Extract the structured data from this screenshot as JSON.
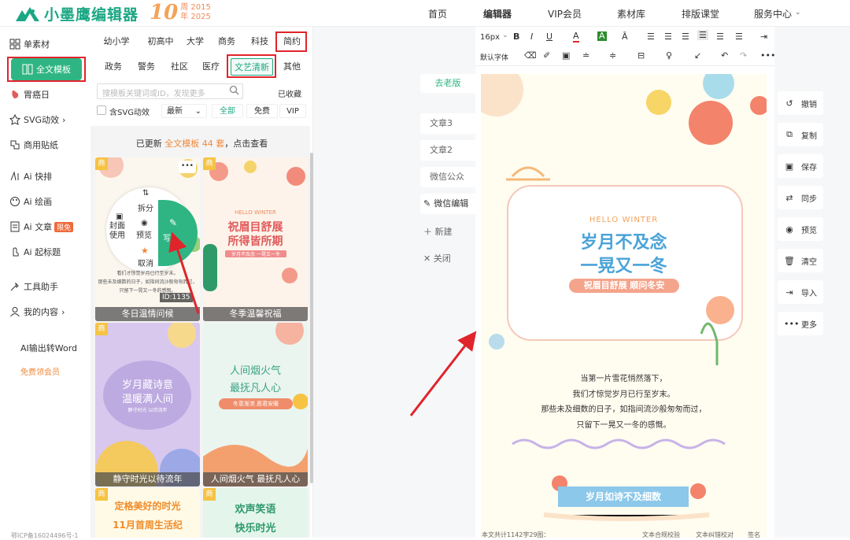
{
  "header": {
    "logo_text": "小墨鹰编辑器",
    "anniversary_num": "10",
    "anniversary_line1": "周 2015",
    "anniversary_line2": "年 2025",
    "nav": [
      "首页",
      "编辑器",
      "VIP会员",
      "素材库",
      "排版课堂",
      "服务中心"
    ]
  },
  "sidebar": {
    "items": [
      {
        "label": "单素材"
      },
      {
        "label": "全文模板"
      },
      {
        "label": "胃癌日"
      },
      {
        "label": "SVG动效",
        "chevron": "›"
      },
      {
        "label": "商用贴纸"
      },
      {
        "label": "Ai 快排"
      },
      {
        "label": "Ai 绘画"
      },
      {
        "label": "Ai 文章",
        "badge": "限免"
      },
      {
        "label": "Ai 起标题"
      },
      {
        "label": "工具助手"
      },
      {
        "label": "我的内容",
        "chevron": "›"
      }
    ],
    "ai_word": "AI输出转Word",
    "free_vip": "免费领会员",
    "icp": "鄂ICP备16024496号-1"
  },
  "templates": {
    "tags_row1": [
      "幼小学",
      "初高中",
      "大学",
      "商务",
      "科技",
      "简约"
    ],
    "tags_row2": [
      "政务",
      "警务",
      "社区",
      "医疗",
      "文艺清新",
      "其他"
    ],
    "search_placeholder": "搜模板关键词或ID，发现更多",
    "favorites": "已收藏",
    "svg_check": "含SVG动效",
    "sort": "最新",
    "filters": [
      "全部",
      "免费",
      "VIP"
    ],
    "update_prefix": "已更新",
    "update_highlight": "全文模板 44 套",
    "update_suffix": "，点击查看",
    "cards": [
      {
        "caption": "冬日温情问候",
        "id": "ID:1135"
      },
      {
        "caption": "冬季温馨祝福",
        "title1": "祝眉目舒展",
        "title2": "所得皆所期",
        "en": "HELLO WINTER",
        "sub": "岁月不及念 一晃又一冬"
      },
      {
        "caption": "静守时光以待流年",
        "title1": "岁月藏诗意",
        "title2": "温暖满人间",
        "sub": "静守时光 以待流年"
      },
      {
        "caption": "人间烟火气 最抚凡人心",
        "title1": "人间烟火气",
        "title2": "最抚凡人心",
        "sub": "冬意渐浓 愿君安暖"
      },
      {
        "title1": "定格美好的时光",
        "title2": "11月首周生活纪"
      },
      {
        "title1": "欢声笑语",
        "title2": "快乐时光"
      }
    ],
    "vip_badge": "商",
    "more": "•••",
    "popup": {
      "split": "拆分",
      "cover": "封面使用",
      "preview": "预览",
      "insert": "写入",
      "cancel": "取消"
    },
    "card1_text": [
      "看们才惊觉岁月已行至岁末。",
      "那些未及细数的日子，如指间流沙般匆匆而过，",
      "只留下一晃又一冬的感慨。"
    ]
  },
  "editor": {
    "version_tab": "去老版",
    "article_tabs": [
      "文章3",
      "文章2",
      "微信公众",
      "微信编辑"
    ],
    "new": "新建",
    "close": "关闭",
    "font_size": "16px",
    "font_name": "默认字体",
    "poster": {
      "en": "HELLO WINTER",
      "title1": "岁月不及念",
      "title2": "一晃又一冬",
      "subtitle": "祝眉目舒展 顺问冬安",
      "body": [
        "当第一片雪花悄然落下，",
        "我们才惊觉岁月已行至岁末。",
        "那些未及细数的日子，如指间流沙般匆匆而过，",
        "只留下一晃又一冬的感慨。"
      ],
      "footer": "岁月如诗不及细数"
    },
    "status_left": "本文共计1142字29图：",
    "status_mid": "文本合规校验",
    "status_mid2": "文本纠错校对",
    "status_right": "签名"
  },
  "right_tools": [
    "撤销",
    "复制",
    "保存",
    "同步",
    "预览",
    "清空",
    "导入",
    "更多"
  ],
  "colors": {
    "brand": "#1ba784",
    "active_bg": "#2fb583",
    "highlight": "#e0242b",
    "orange": "#f4a259"
  }
}
